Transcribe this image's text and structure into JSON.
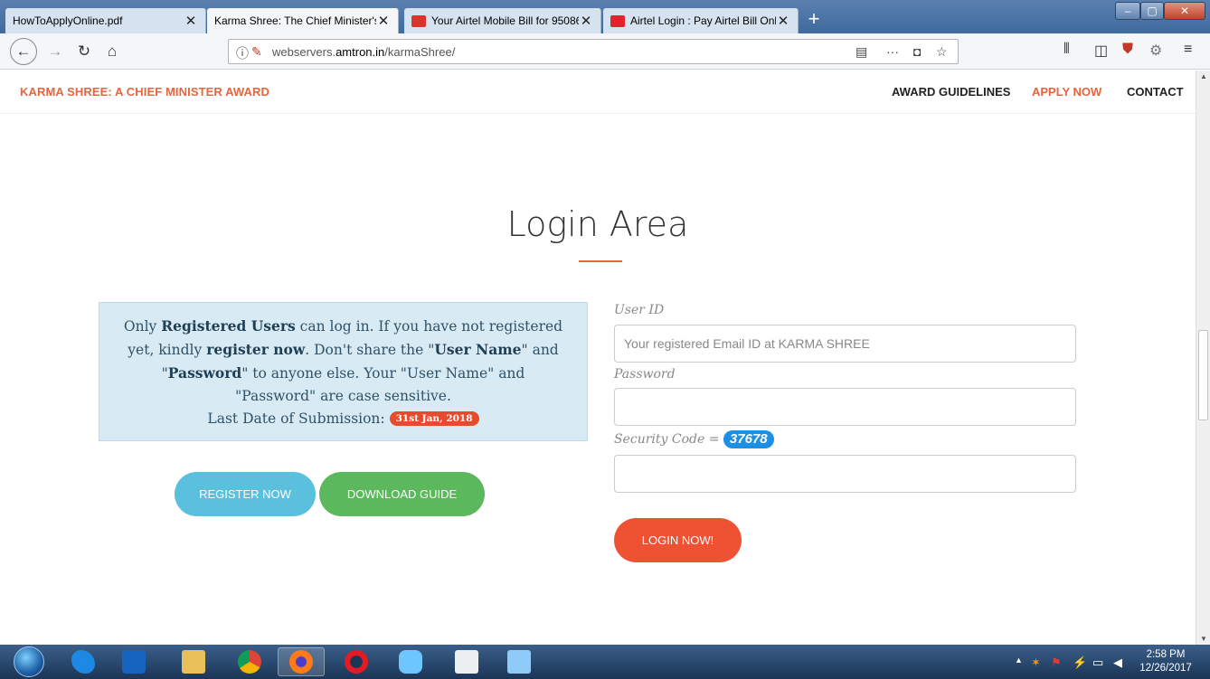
{
  "browser": {
    "tabs": [
      {
        "title": "HowToApplyOnline.pdf",
        "active": false
      },
      {
        "title": "Karma Shree: The Chief Minister's A",
        "active": true
      },
      {
        "title": "Your Airtel Mobile Bill for 95086",
        "active": false
      },
      {
        "title": "Airtel Login : Pay Airtel Bill Onli",
        "active": false
      }
    ],
    "url": {
      "prefix": "webservers.",
      "domain": "amtron.in",
      "path": "/karmaShree/"
    }
  },
  "site": {
    "brand": "KARMA SHREE: A CHIEF MINISTER AWARD",
    "nav": {
      "award_guidelines": "AWARD GUIDELINES",
      "apply_now": "APPLY NOW",
      "contact": "CONTACT"
    }
  },
  "login": {
    "title": "Login Area",
    "notice": {
      "p1": "Only ",
      "b1": "Registered Users",
      "p2": " can log in. If you have not registered yet, kindly ",
      "b2": "register now",
      "p3": ". Don't share the \"",
      "b3": "User Name",
      "p4": "\" and \"",
      "b4": "Password",
      "p5": "\" to anyone else. Your \"User Name\" and \"Password\" are case sensitive.",
      "deadline_label": "Last Date of Submission:",
      "deadline_value": "31st Jan, 2018"
    },
    "register_button": "REGISTER NOW",
    "download_button": "DOWNLOAD GUIDE",
    "user_id_label": "User ID",
    "user_id_placeholder": "Your registered Email ID at KARMA SHREE",
    "user_id_value": "",
    "password_label": "Password",
    "password_value": "",
    "security_label": "Security Code =",
    "security_code": "37678",
    "security_value": "",
    "login_button": "LOGIN NOW!"
  },
  "taskbar": {
    "time": "2:58 PM",
    "date": "12/26/2017"
  }
}
